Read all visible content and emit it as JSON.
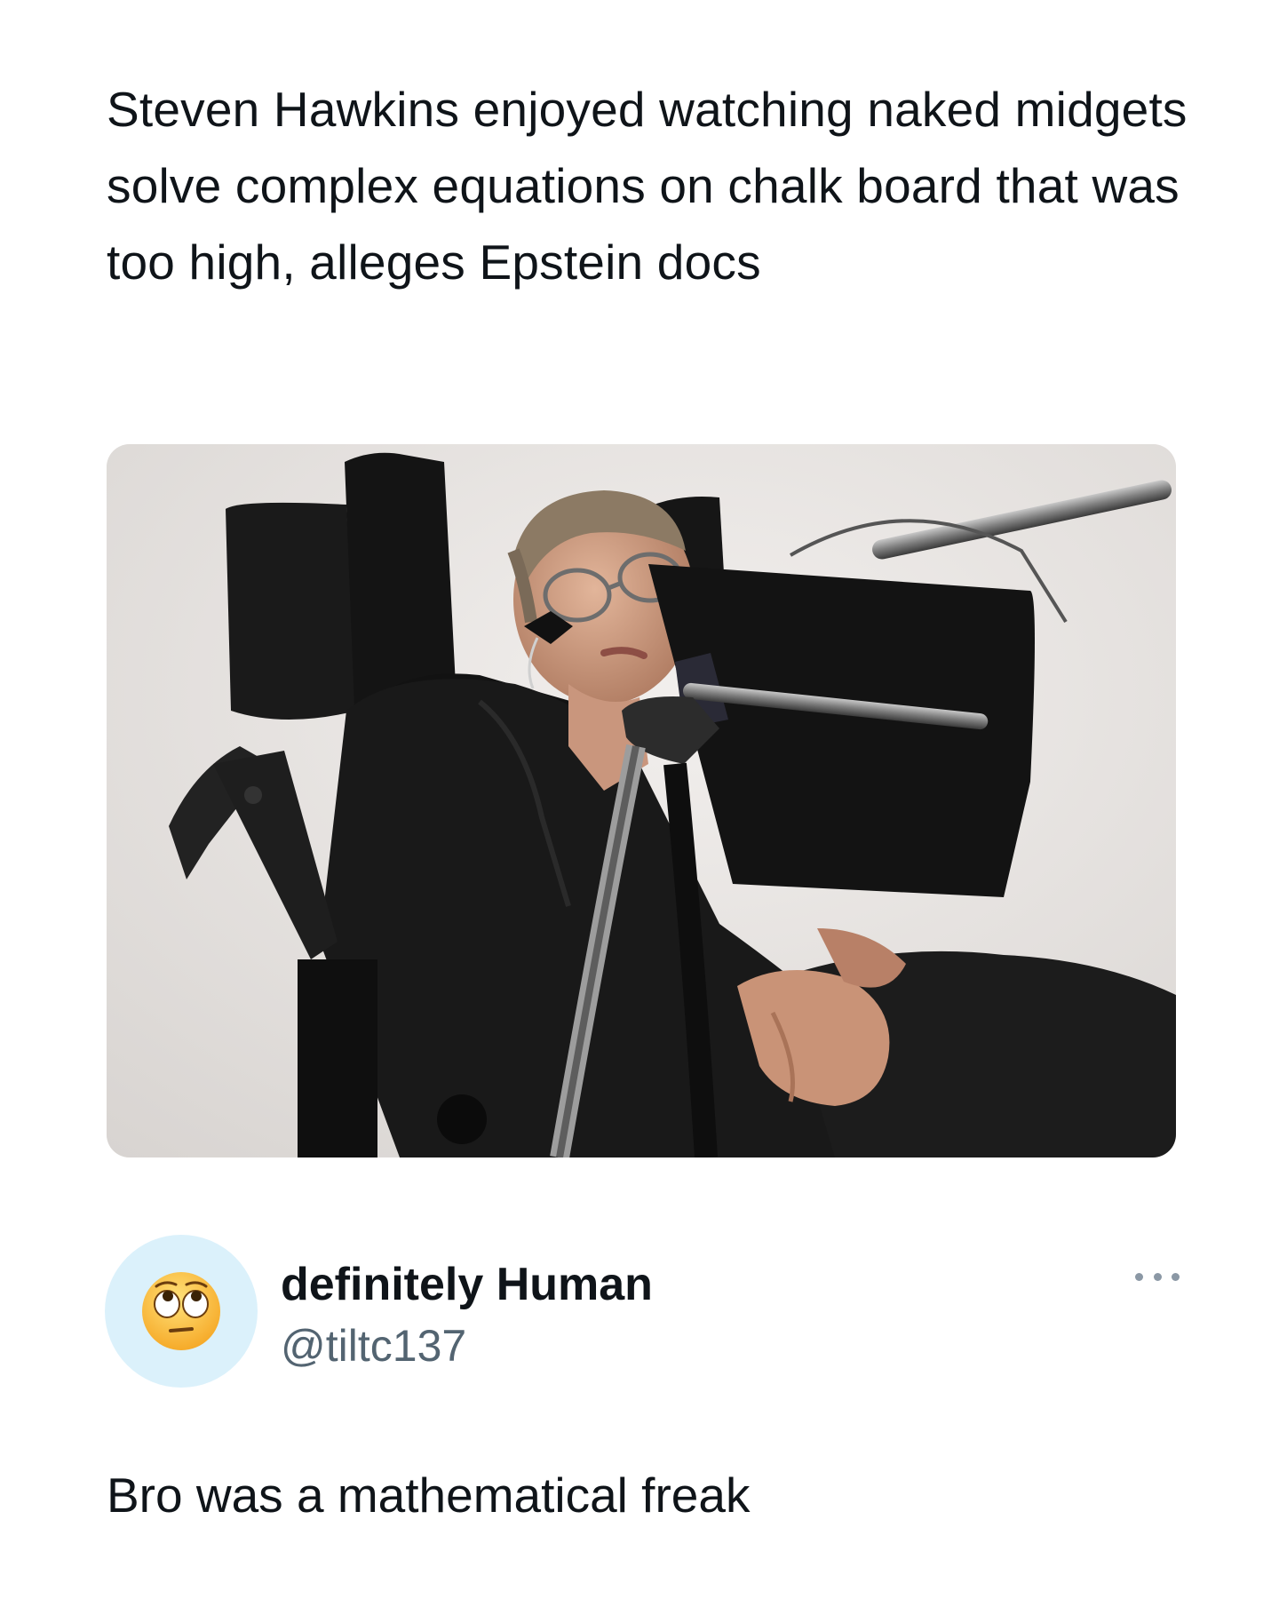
{
  "post": {
    "headline": "Steven Hawkins enjoyed watching naked midgets solve complex equations on chalk board that was too high, alleges Epstein docs",
    "media_alt": "Photo of Stephen Hawking seated in his wheelchair with speech computer"
  },
  "author": {
    "avatar_icon": "face-with-rolling-eyes-emoji-icon",
    "display_name": "definitely Human",
    "handle": "@tiltc137"
  },
  "more_icon": "ellipsis-icon",
  "reply": {
    "text": "Bro was a mathematical freak"
  },
  "colors": {
    "text_primary": "#0f1419",
    "text_secondary": "#536471",
    "avatar_bg": "#dbf1fb",
    "background": "#ffffff"
  }
}
